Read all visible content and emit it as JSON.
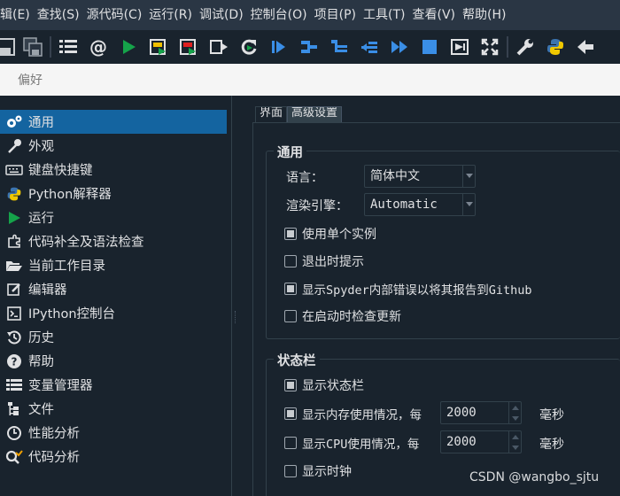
{
  "menubar": {
    "items": [
      "辑(E)",
      "查找(S)",
      "源代码(C)",
      "运行(R)",
      "调试(D)",
      "控制台(O)",
      "项目(P)",
      "工具(T)",
      "查看(V)",
      "帮助(H)"
    ]
  },
  "toolbar": {
    "buttons": [
      "save-icon",
      "save-all-icon",
      "list-icon",
      "at-icon",
      "run-icon",
      "run-cell-icon",
      "run-cell-advance-icon",
      "run-selection-icon",
      "rerun-icon",
      "debug-icon",
      "step-icon",
      "step-into-icon",
      "step-return-icon",
      "continue-icon",
      "stop-icon",
      "maximize-pane-icon",
      "fullscreen-icon",
      "preferences-icon",
      "python-path-icon",
      "back-arrow-icon"
    ]
  },
  "dialog": {
    "title": "偏好"
  },
  "nav": {
    "items": [
      {
        "label": "通用",
        "icon": "gears-icon"
      },
      {
        "label": "外观",
        "icon": "eyedropper-icon"
      },
      {
        "label": "键盘快捷键",
        "icon": "keyboard-icon"
      },
      {
        "label": "Python解释器",
        "icon": "python-icon"
      },
      {
        "label": "运行",
        "icon": "play-icon"
      },
      {
        "label": "代码补全及语法检查",
        "icon": "puzzle-icon"
      },
      {
        "label": "当前工作目录",
        "icon": "folder-open-icon"
      },
      {
        "label": "编辑器",
        "icon": "edit-icon"
      },
      {
        "label": "IPython控制台",
        "icon": "terminal-icon"
      },
      {
        "label": "历史",
        "icon": "history-icon"
      },
      {
        "label": "帮助",
        "icon": "help-icon"
      },
      {
        "label": "变量管理器",
        "icon": "table-icon"
      },
      {
        "label": "文件",
        "icon": "file-tree-icon"
      },
      {
        "label": "性能分析",
        "icon": "profiler-icon"
      },
      {
        "label": "代码分析",
        "icon": "code-analysis-icon"
      }
    ]
  },
  "tabs": {
    "items": [
      "界面",
      "高级设置"
    ]
  },
  "general_group": {
    "title": "通用",
    "language_label": "语言：",
    "language_value": "简体中文",
    "engine_label": "渲染引擎：",
    "engine_value": "Automatic",
    "checkboxes": [
      {
        "label": "使用单个实例",
        "checked": true
      },
      {
        "label": "退出时提示",
        "checked": false
      },
      {
        "label": "显示Spyder内部错误以将其报告到Github",
        "checked": true
      },
      {
        "label": "在启动时检查更新",
        "checked": false
      }
    ]
  },
  "statusbar_group": {
    "title": "状态栏",
    "show_statusbar": {
      "label": "显示状态栏",
      "checked": true
    },
    "show_memory": {
      "label": "显示内存使用情况，每",
      "checked": true,
      "value": "2000",
      "unit": "毫秒"
    },
    "show_cpu": {
      "label": "显示CPU使用情况，每",
      "checked": false,
      "value": "2000",
      "unit": "毫秒"
    },
    "show_clock": {
      "label": "显示时钟",
      "checked": false
    }
  },
  "watermark": "CSDN @wangbo_sjtu"
}
